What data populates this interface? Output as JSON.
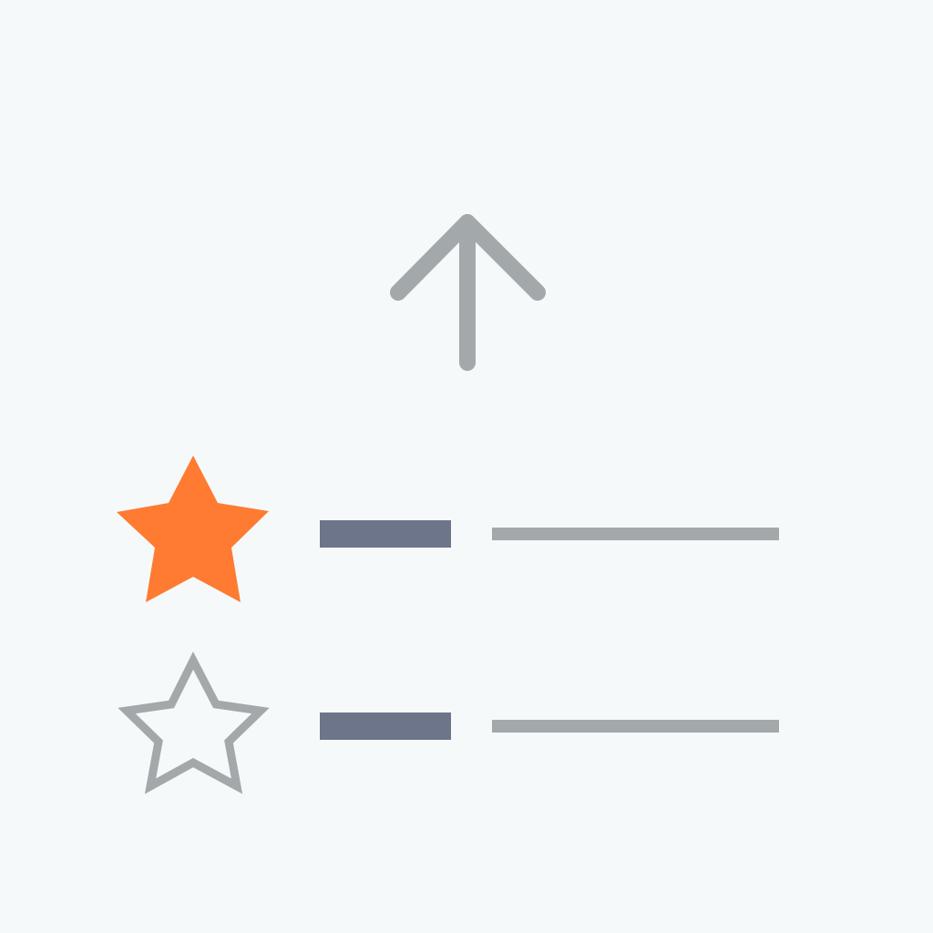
{
  "icons": {
    "arrow": "arrow-up-icon",
    "star_filled": "star-filled-icon",
    "star_outline": "star-outline-icon"
  },
  "colors": {
    "background": "#f6f9fa",
    "arrow": "#a3a8ab",
    "star_filled": "#ff7b31",
    "star_outline": "#a3a8ab",
    "bar_dark": "#6c7589",
    "bar_light": "#a3a8ab"
  },
  "list": {
    "items": [
      {
        "starred": true
      },
      {
        "starred": false
      }
    ]
  }
}
